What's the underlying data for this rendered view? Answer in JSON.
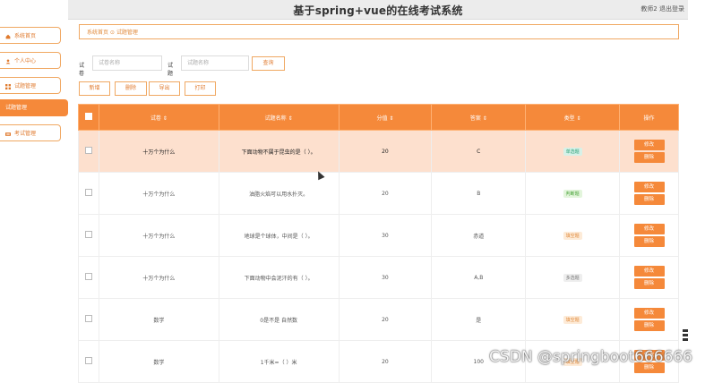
{
  "header": {
    "title": "基于spring+vue的在线考试系统",
    "user_info": "教师2 退出登录"
  },
  "breadcrumb": {
    "text": "系统首页 ⊙ 试题管理"
  },
  "sidebar": {
    "items": [
      {
        "label": "系统首页",
        "icon": "home-icon"
      },
      {
        "label": "个人中心",
        "icon": "user-icon"
      },
      {
        "label": "试题管理",
        "icon": "grid-icon"
      },
      {
        "label": "试题管理",
        "icon": ""
      },
      {
        "label": "考试管理",
        "icon": "exam-icon"
      }
    ]
  },
  "search": {
    "paper_label": "试卷",
    "paper_placeholder": "试卷名称",
    "question_label": "试题",
    "question_placeholder": "试题名称",
    "query_button": "查询"
  },
  "toolbar": {
    "add": "新增",
    "delete": "删除",
    "export": "导出",
    "print": "打印"
  },
  "table": {
    "headers": [
      "试卷 ⇕",
      "试题名称 ⇕",
      "分值 ⇕",
      "答案 ⇕",
      "类型 ⇕",
      "操作"
    ],
    "rows": [
      {
        "paper": "十万个为什么",
        "question": "下面动物不属于昆虫的是（ ）。",
        "score": "20",
        "answer": "C",
        "type": "单选题",
        "type_kind": "single"
      },
      {
        "paper": "十万个为什么",
        "question": "油脂火焰可以用水扑灭。",
        "score": "20",
        "answer": "B",
        "type": "判断题",
        "type_kind": "judge"
      },
      {
        "paper": "十万个为什么",
        "question": "地球是个球体，中间是（ ）。",
        "score": "30",
        "answer": "赤道",
        "type": "填空题",
        "type_kind": "fill"
      },
      {
        "paper": "十万个为什么",
        "question": "下面动物中会泥汗的有（ ）。",
        "score": "30",
        "answer": "A,B",
        "type": "多选题",
        "type_kind": "multi"
      },
      {
        "paper": "数学",
        "question": "0是不是 自然数",
        "score": "20",
        "answer": "是",
        "type": "填空题",
        "type_kind": "fill"
      },
      {
        "paper": "数学",
        "question": "1千米=（ ）米",
        "score": "20",
        "answer": "100",
        "type": "填空题",
        "type_kind": "fill"
      }
    ],
    "edit_label": "修改",
    "delete_label": "删除"
  },
  "watermark": "CSDN @springboot666666",
  "colors": {
    "accent": "#f5893a",
    "accent_border": "#f0a862",
    "selected_row": "#fde0ce"
  }
}
